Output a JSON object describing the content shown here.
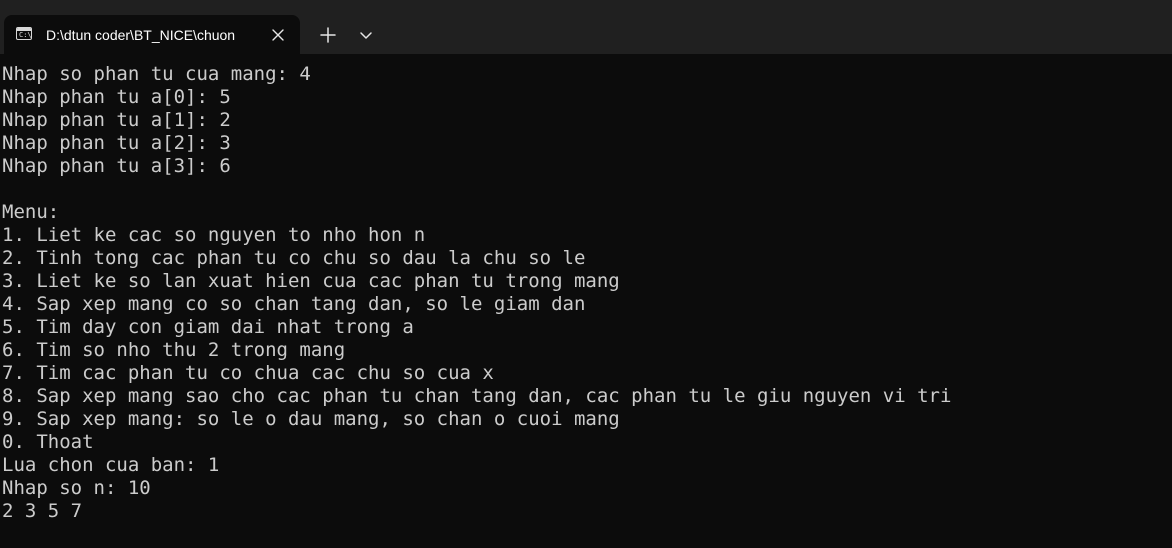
{
  "window": {
    "tab_title": "D:\\dtun coder\\BT_NICE\\chuon",
    "tab_icon": "terminal-icon",
    "close_icon": "close-icon",
    "new_tab_icon": "plus-icon",
    "dropdown_icon": "chevron-down-icon"
  },
  "terminal": {
    "lines": [
      "Nhap so phan tu cua mang: 4",
      "Nhap phan tu a[0]: 5",
      "Nhap phan tu a[1]: 2",
      "Nhap phan tu a[2]: 3",
      "Nhap phan tu a[3]: 6",
      "",
      "Menu:",
      "1. Liet ke cac so nguyen to nho hon n",
      "2. Tinh tong cac phan tu co chu so dau la chu so le",
      "3. Liet ke so lan xuat hien cua cac phan tu trong mang",
      "4. Sap xep mang co so chan tang dan, so le giam dan",
      "5. Tim day con giam dai nhat trong a",
      "6. Tim so nho thu 2 trong mang",
      "7. Tim cac phan tu co chua cac chu so cua x",
      "8. Sap xep mang sao cho cac phan tu chan tang dan, cac phan tu le giu nguyen vi tri",
      "9. Sap xep mang: so le o dau mang, so chan o cuoi mang",
      "0. Thoat",
      "Lua chon cua ban: 1",
      "Nhap so n: 10",
      "2 3 5 7"
    ]
  },
  "colors": {
    "background": "#0c0c0c",
    "titlebar": "#202020",
    "text": "#cccccc"
  }
}
